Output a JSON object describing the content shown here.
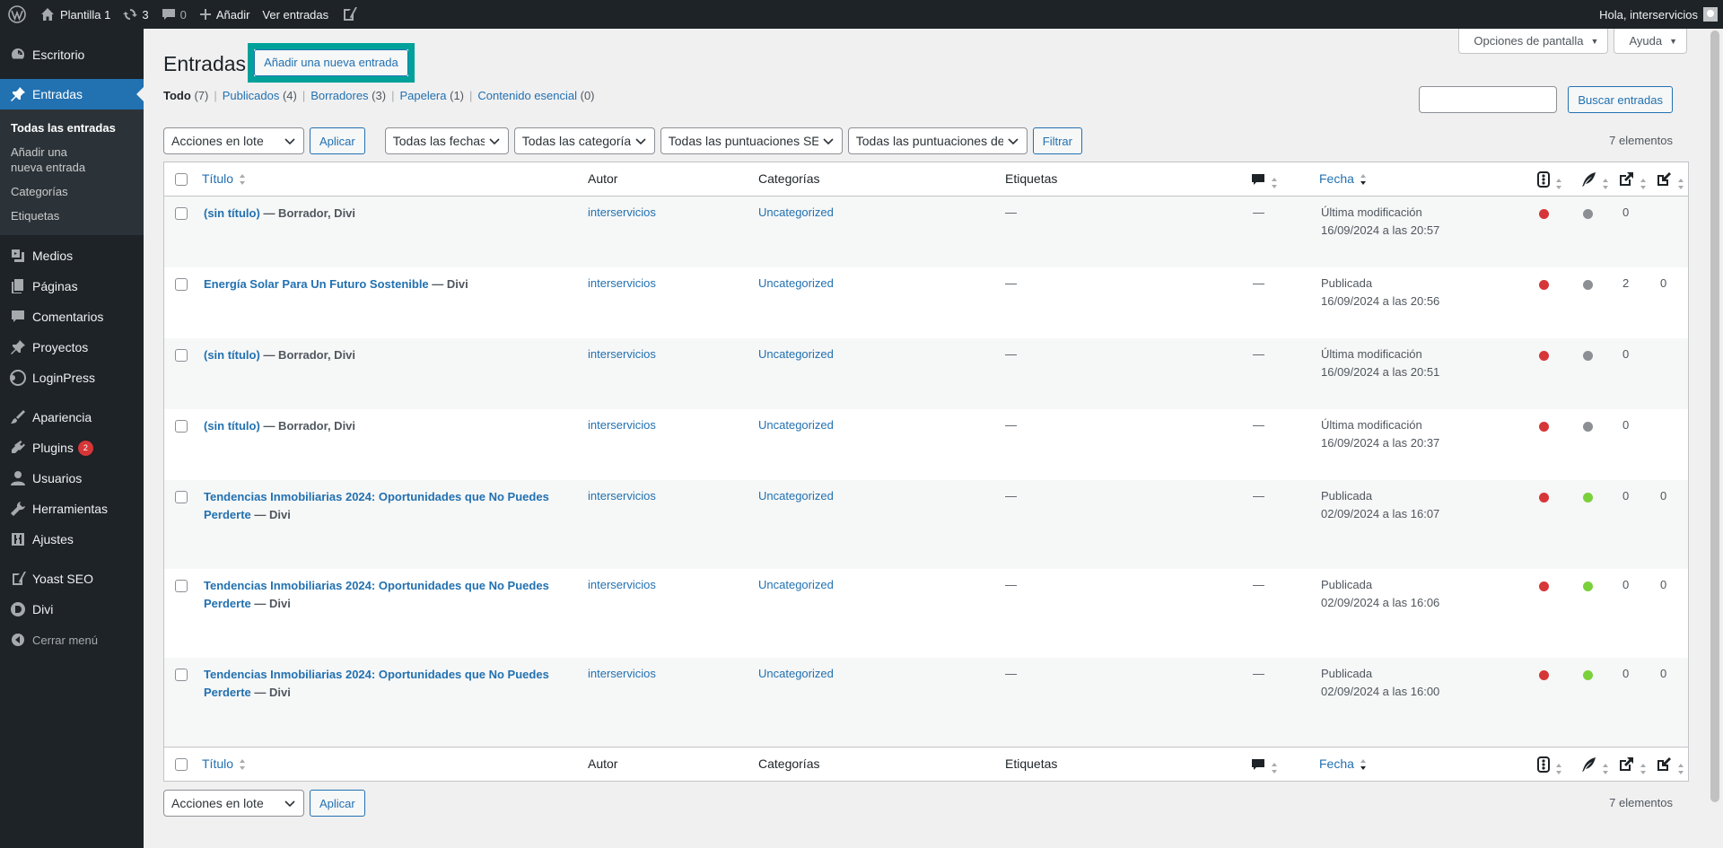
{
  "adminbar": {
    "site_name": "Plantilla 1",
    "updates_count": "3",
    "comments_count": "0",
    "add_label": "Añadir",
    "view_posts": "Ver entradas",
    "greeting": "Hola, interservicios"
  },
  "sidebar": {
    "items": [
      {
        "label": "Escritorio",
        "icon": "dashboard-icon"
      },
      {
        "label": "Entradas",
        "icon": "pin-icon"
      },
      {
        "label": "Medios",
        "icon": "media-icon"
      },
      {
        "label": "Páginas",
        "icon": "pages-icon"
      },
      {
        "label": "Comentarios",
        "icon": "comments-icon"
      },
      {
        "label": "Proyectos",
        "icon": "pin-icon"
      },
      {
        "label": "LoginPress",
        "icon": "loginpress-icon"
      },
      {
        "label": "Apariencia",
        "icon": "brush-icon"
      },
      {
        "label": "Plugins",
        "icon": "plugin-icon",
        "badge": "2"
      },
      {
        "label": "Usuarios",
        "icon": "user-icon"
      },
      {
        "label": "Herramientas",
        "icon": "wrench-icon"
      },
      {
        "label": "Ajustes",
        "icon": "settings-icon"
      },
      {
        "label": "Yoast SEO",
        "icon": "yoast-icon"
      },
      {
        "label": "Divi",
        "icon": "divi-icon"
      },
      {
        "label": "Cerrar menú",
        "icon": "collapse-icon"
      }
    ],
    "submenu": [
      "Todas las entradas",
      "Añadir una nueva entrada",
      "Categorías",
      "Etiquetas"
    ]
  },
  "screen_options": "Opciones de pantalla",
  "help": "Ayuda",
  "page_title": "Entradas",
  "add_new": "Añadir una nueva entrada",
  "views": [
    {
      "label": "Todo",
      "count": "(7)"
    },
    {
      "label": "Publicados",
      "count": "(4)"
    },
    {
      "label": "Borradores",
      "count": "(3)"
    },
    {
      "label": "Papelera",
      "count": "(1)"
    },
    {
      "label": "Contenido esencial",
      "count": "(0)"
    }
  ],
  "search_button": "Buscar entradas",
  "filters": {
    "bulk": "Acciones en lote",
    "apply": "Aplicar",
    "dates": "Todas las fechas",
    "categories": "Todas las categorías",
    "seo": "Todas las puntuaciones SEO",
    "readability": "Todas las puntuaciones de legibilidad",
    "filter": "Filtrar",
    "items": "7 elementos"
  },
  "columns": {
    "title": "Título",
    "author": "Autor",
    "categories": "Categorías",
    "tags": "Etiquetas",
    "date": "Fecha"
  },
  "rows": [
    {
      "title": "(sin título)",
      "state": " — Borrador, Divi",
      "author": "interservicios",
      "category": "Uncategorized",
      "tags": "—",
      "comments": "—",
      "status": "Última modificación",
      "date": "16/09/2024 a las 20:57",
      "seo": "#d63638",
      "read": "#8c8f94",
      "links": "0",
      "linked": ""
    },
    {
      "title": "Energía Solar Para Un Futuro Sostenible",
      "state": " — Divi",
      "author": "interservicios",
      "category": "Uncategorized",
      "tags": "—",
      "comments": "—",
      "status": "Publicada",
      "date": "16/09/2024 a las 20:56",
      "seo": "#d63638",
      "read": "#8c8f94",
      "links": "2",
      "linked": "0"
    },
    {
      "title": "(sin título)",
      "state": " — Borrador, Divi",
      "author": "interservicios",
      "category": "Uncategorized",
      "tags": "—",
      "comments": "—",
      "status": "Última modificación",
      "date": "16/09/2024 a las 20:51",
      "seo": "#d63638",
      "read": "#8c8f94",
      "links": "0",
      "linked": ""
    },
    {
      "title": "(sin título)",
      "state": " — Borrador, Divi",
      "author": "interservicios",
      "category": "Uncategorized",
      "tags": "—",
      "comments": "—",
      "status": "Última modificación",
      "date": "16/09/2024 a las 20:37",
      "seo": "#d63638",
      "read": "#8c8f94",
      "links": "0",
      "linked": ""
    },
    {
      "title": "Tendencias Inmobiliarias 2024: Oportunidades que No Puedes Perderte",
      "state": " — Divi",
      "author": "interservicios",
      "category": "Uncategorized",
      "tags": "—",
      "comments": "—",
      "status": "Publicada",
      "date": "02/09/2024 a las 16:07",
      "seo": "#d63638",
      "read": "#7ad03a",
      "links": "0",
      "linked": "0"
    },
    {
      "title": "Tendencias Inmobiliarias 2024: Oportunidades que No Puedes Perderte",
      "state": " — Divi",
      "author": "interservicios",
      "category": "Uncategorized",
      "tags": "—",
      "comments": "—",
      "status": "Publicada",
      "date": "02/09/2024 a las 16:06",
      "seo": "#d63638",
      "read": "#7ad03a",
      "links": "0",
      "linked": "0"
    },
    {
      "title": "Tendencias Inmobiliarias 2024: Oportunidades que No Puedes Perderte",
      "state": " — Divi",
      "author": "interservicios",
      "category": "Uncategorized",
      "tags": "—",
      "comments": "—",
      "status": "Publicada",
      "date": "02/09/2024 a las 16:00",
      "seo": "#d63638",
      "read": "#7ad03a",
      "links": "0",
      "linked": "0"
    }
  ]
}
